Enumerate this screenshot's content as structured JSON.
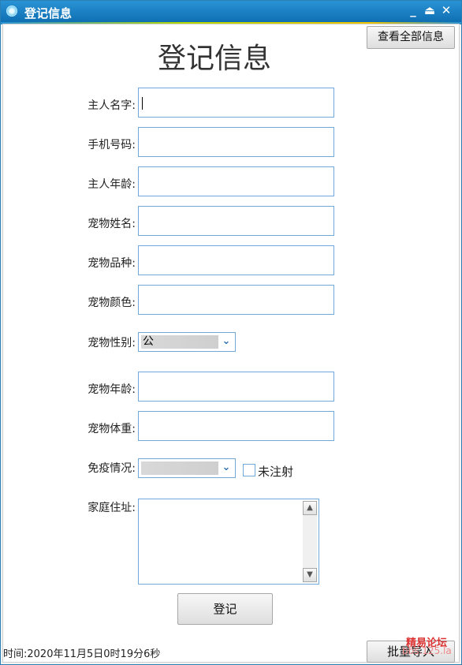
{
  "window": {
    "title": "登记信息"
  },
  "header": {
    "view_all_label": "查看全部信息",
    "heading": "登记信息"
  },
  "form": {
    "owner_name_label": "主人名字:",
    "phone_label": "手机号码:",
    "owner_age_label": "主人年龄:",
    "pet_name_label": "宠物姓名:",
    "pet_breed_label": "宠物品种:",
    "pet_color_label": "宠物颜色:",
    "pet_gender_label": "宠物性别:",
    "pet_gender_value": "公",
    "pet_age_label": "宠物年龄:",
    "pet_weight_label": "宠物体重:",
    "vaccine_label": "免疫情况:",
    "vaccine_value": "",
    "not_vaccinated_label": "未注射",
    "address_label": "家庭住址:",
    "register_button": "登记"
  },
  "footer": {
    "time_text": "时间:2020年11月5日0时19分6秒",
    "batch_button": "批量导入"
  },
  "watermark": {
    "line1": "精易论坛",
    "line2": "bbs.125.la"
  },
  "colors": {
    "title_bar": "#1b7fc4",
    "field_border": "#6fa8d9",
    "watermark": "#dd3333"
  },
  "icons": {
    "app": "app-icon",
    "minimize": "minimize-icon",
    "restore": "restore-icon",
    "close": "close-icon",
    "dropdown": "chevron-down-icon"
  }
}
